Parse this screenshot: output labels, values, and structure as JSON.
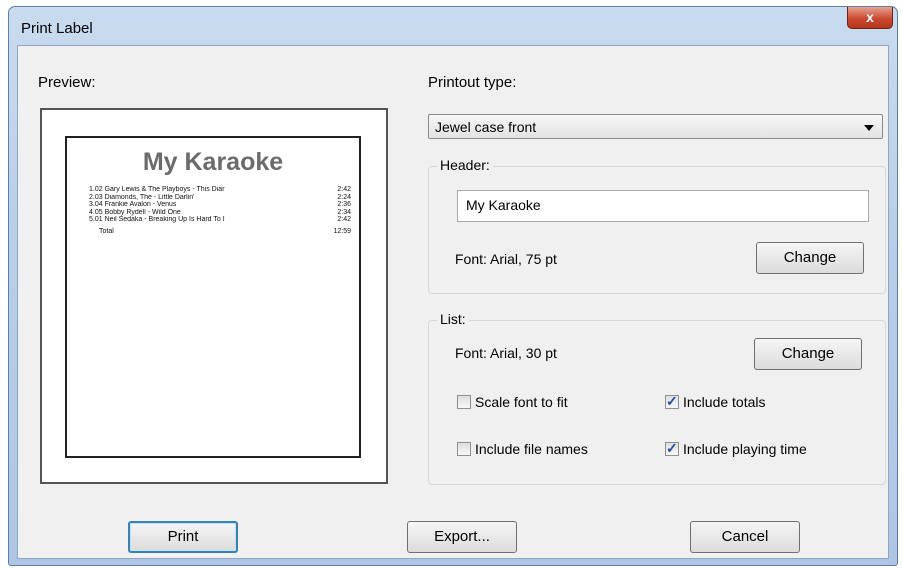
{
  "window": {
    "title": "Print Label",
    "close_label": "x"
  },
  "preview": {
    "label": "Preview:",
    "header": "My Karaoke",
    "tracks": [
      {
        "name": "1.02 Gary Lewis & The Playboys - This Diar",
        "time": "2:42"
      },
      {
        "name": "2.03 Diamonds, The - Little Darlin'",
        "time": "2:24"
      },
      {
        "name": "3.04 Frankie Avalon - Venus",
        "time": "2:36"
      },
      {
        "name": "4.05 Bobby Rydell - Wild One",
        "time": "2:34"
      },
      {
        "name": "5.01 Neil Sedaka - Breaking Up Is Hard To I",
        "time": "2:42"
      }
    ],
    "total_label": "Total",
    "total_time": "12:59"
  },
  "printout": {
    "label": "Printout type:",
    "value": "Jewel case front"
  },
  "header_group": {
    "legend": "Header:",
    "text_value": "My Karaoke",
    "font_text": "Font:  Arial, 75 pt",
    "change_label": "Change"
  },
  "list_group": {
    "legend": "List:",
    "font_text": "Font:  Arial, 30 pt",
    "change_label": "Change",
    "scale_font_label": "Scale font to fit",
    "scale_font_checked": false,
    "include_totals_label": "Include totals",
    "include_totals_checked": true,
    "include_file_names_label": "Include file names",
    "include_file_names_checked": false,
    "include_playing_time_label": "Include playing time",
    "include_playing_time_checked": true
  },
  "footer": {
    "print_label": "Print",
    "export_label": "Export...",
    "cancel_label": "Cancel"
  }
}
